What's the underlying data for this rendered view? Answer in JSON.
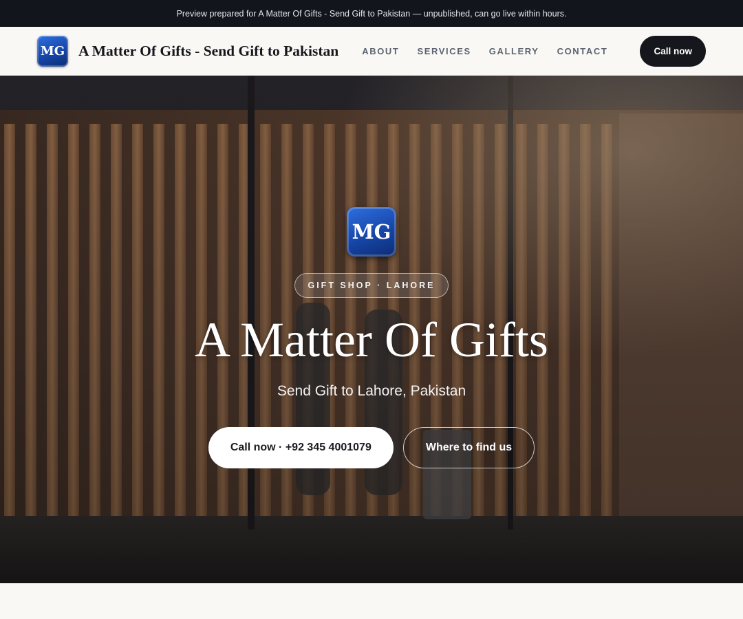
{
  "banner": {
    "text": "Preview prepared for A Matter Of Gifts - Send Gift to Pakistan — unpublished, can go live within hours."
  },
  "header": {
    "logo_text": "MG",
    "brand_name": "A Matter Of Gifts - Send Gift to Pakistan",
    "nav": [
      {
        "label": "ABOUT"
      },
      {
        "label": "SERVICES"
      },
      {
        "label": "GALLERY"
      },
      {
        "label": "CONTACT"
      }
    ],
    "cta_label": "Call now"
  },
  "hero": {
    "logo_text": "MG",
    "badge": "GIFT SHOP · LAHORE",
    "title": "A Matter Of Gifts",
    "subtitle": "Send Gift to Lahore, Pakistan",
    "primary_button": "Call now · +92 345 4001079",
    "secondary_button": "Where to find us",
    "background_image": "shop-window-photo"
  },
  "colors": {
    "topbar_bg": "#12151c",
    "accent_dark": "#15171c",
    "logo_blue": "#1646a8",
    "page_bg": "#f9f8f5"
  }
}
